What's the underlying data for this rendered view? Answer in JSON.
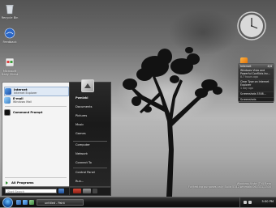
{
  "desktop": {
    "icons": [
      {
        "name": "recycle-bin",
        "label": "Recycle Bin"
      },
      {
        "name": "feedback",
        "label": "Feedback"
      },
      {
        "name": "microsoft-daily-client",
        "label": "Microsoft Daily Client"
      }
    ],
    "watermark_line1": "Windows Vista (TM) Beta",
    "watermark_line2": "For testing purposes only. Build 5342.winmain.060331-1300"
  },
  "sidebar": {
    "feed": {
      "title": "Internet",
      "count": "4/4",
      "items": [
        {
          "title": "Windows Vista and Powerful Conflicts Inc...",
          "time": "8.7 hours ago"
        },
        {
          "title": "Clear Type on Internet Explorer",
          "time": "1 day ago"
        },
        {
          "title": "Screenshots 5308...",
          "time": ""
        },
        {
          "title": "Screenshots",
          "time": ""
        }
      ]
    }
  },
  "start_menu": {
    "pinned": [
      {
        "title": "Internet",
        "subtitle": "Internet Explorer"
      },
      {
        "title": "E-mail",
        "subtitle": "Windows Mail"
      }
    ],
    "recent": [
      {
        "title": "Command Prompt"
      }
    ],
    "all_programs": "All Programs",
    "search_placeholder": "Start Search",
    "right_items": [
      "Pwnizkl",
      "Documents",
      "Pictures",
      "Music",
      "Games",
      "Computer",
      "Network",
      "Connect To",
      "Control Panel",
      "Run..."
    ]
  },
  "taskbar": {
    "windows": [
      {
        "label": "untitled - Paint"
      }
    ],
    "clock": "5:50 PM"
  }
}
